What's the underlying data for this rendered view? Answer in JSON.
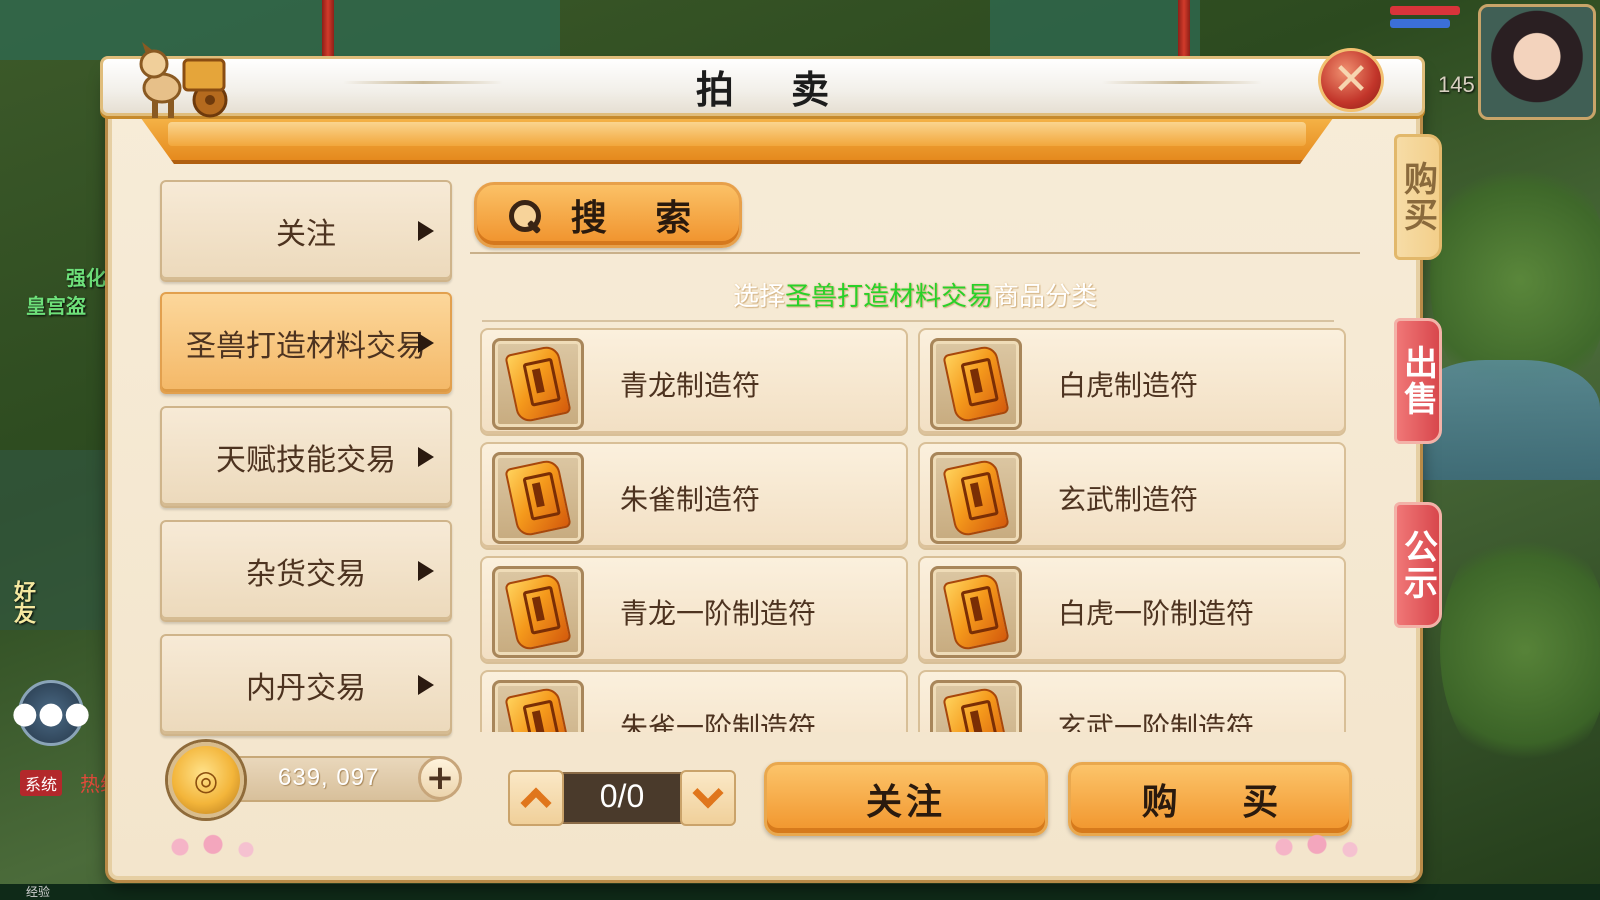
{
  "title": "拍 卖",
  "close_label": "✕",
  "side_tabs": [
    {
      "label": "购买"
    },
    {
      "label": "出售"
    },
    {
      "label": "公示"
    }
  ],
  "categories": [
    {
      "label": "关注",
      "active": false
    },
    {
      "label": "圣兽打造材料交易",
      "active": true
    },
    {
      "label": "天赋技能交易",
      "active": false
    },
    {
      "label": "杂货交易",
      "active": false
    },
    {
      "label": "内丹交易",
      "active": false
    }
  ],
  "search": {
    "label": "搜 索"
  },
  "hint": {
    "prefix": "选择",
    "highlight": "圣兽打造材料交易",
    "suffix": "商品分类"
  },
  "items": [
    {
      "name": "青龙制造符"
    },
    {
      "name": "白虎制造符"
    },
    {
      "name": "朱雀制造符"
    },
    {
      "name": "玄武制造符"
    },
    {
      "name": "青龙一阶制造符"
    },
    {
      "name": "白虎一阶制造符"
    },
    {
      "name": "朱雀一阶制造符"
    },
    {
      "name": "玄武一阶制造符"
    }
  ],
  "currency": {
    "value": "639, 097",
    "add_label": "+"
  },
  "pager": {
    "text": "0/0"
  },
  "actions": {
    "follow": "关注",
    "buy": "购 买"
  },
  "hud": {
    "level_text": "145",
    "left_labels": [
      "好友",
      "强化",
      "皇宫盗"
    ],
    "system_tag": "系统",
    "system_text": "热线啊!",
    "exp_label": "经验"
  },
  "colors": {
    "accent": "#f0922c",
    "highlight": "#29d129",
    "panel": "#f3e5cc",
    "sell_tab": "#d8474c"
  }
}
